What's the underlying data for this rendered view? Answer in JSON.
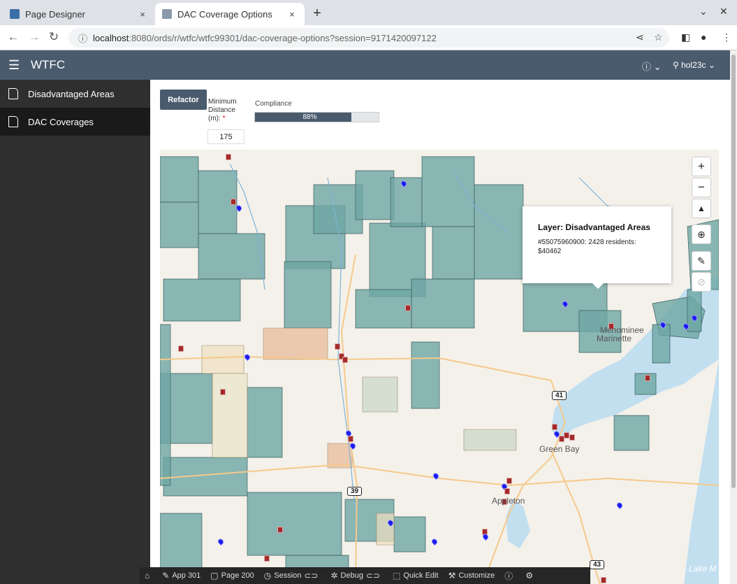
{
  "browser": {
    "tabs": [
      {
        "title": "Page Designer",
        "favicon_color": "#3a6fa8"
      },
      {
        "title": "DAC Coverage Options",
        "favicon_color": "#8a9aaa"
      }
    ],
    "close_glyph": "×",
    "new_tab_glyph": "+",
    "url_host": "localhost",
    "url_rest": ":8080/ords/r/wtfc/wtfc99301/dac-coverage-options?session=9171420097122"
  },
  "app": {
    "title": "WTFC",
    "user": "hol23c",
    "help_icon": "help-circle-icon"
  },
  "sidebar": {
    "items": [
      {
        "label": "Disadvantaged Areas"
      },
      {
        "label": "DAC Coverages"
      }
    ]
  },
  "controls": {
    "refactor_label": "Refactor",
    "min_distance_label": "Minimum Distance (m):",
    "required_marker": "*",
    "min_distance_value": "175",
    "compliance_label": "Compliance",
    "compliance_value": 0.88,
    "compliance_text": "88%"
  },
  "map": {
    "popup_title": "Layer: Disadvantaged Areas",
    "popup_body": "#55075960900: 2428 residents: $40462",
    "place_labels": [
      "Menominee",
      "Marinette",
      "Green Bay",
      "Appleton",
      "Lake M"
    ],
    "highway_shields": [
      "41",
      "39",
      "43"
    ],
    "colors": {
      "area": "#6ea6a4",
      "water": "#c2dff0",
      "marker_red": "#a52a2a",
      "marker_blue": "#1c1cf0",
      "land": "#f4f1ea"
    }
  },
  "devbar": {
    "items": [
      "App 301",
      "Page 200",
      "Session",
      "Debug",
      "Quick Edit",
      "Customize"
    ]
  }
}
